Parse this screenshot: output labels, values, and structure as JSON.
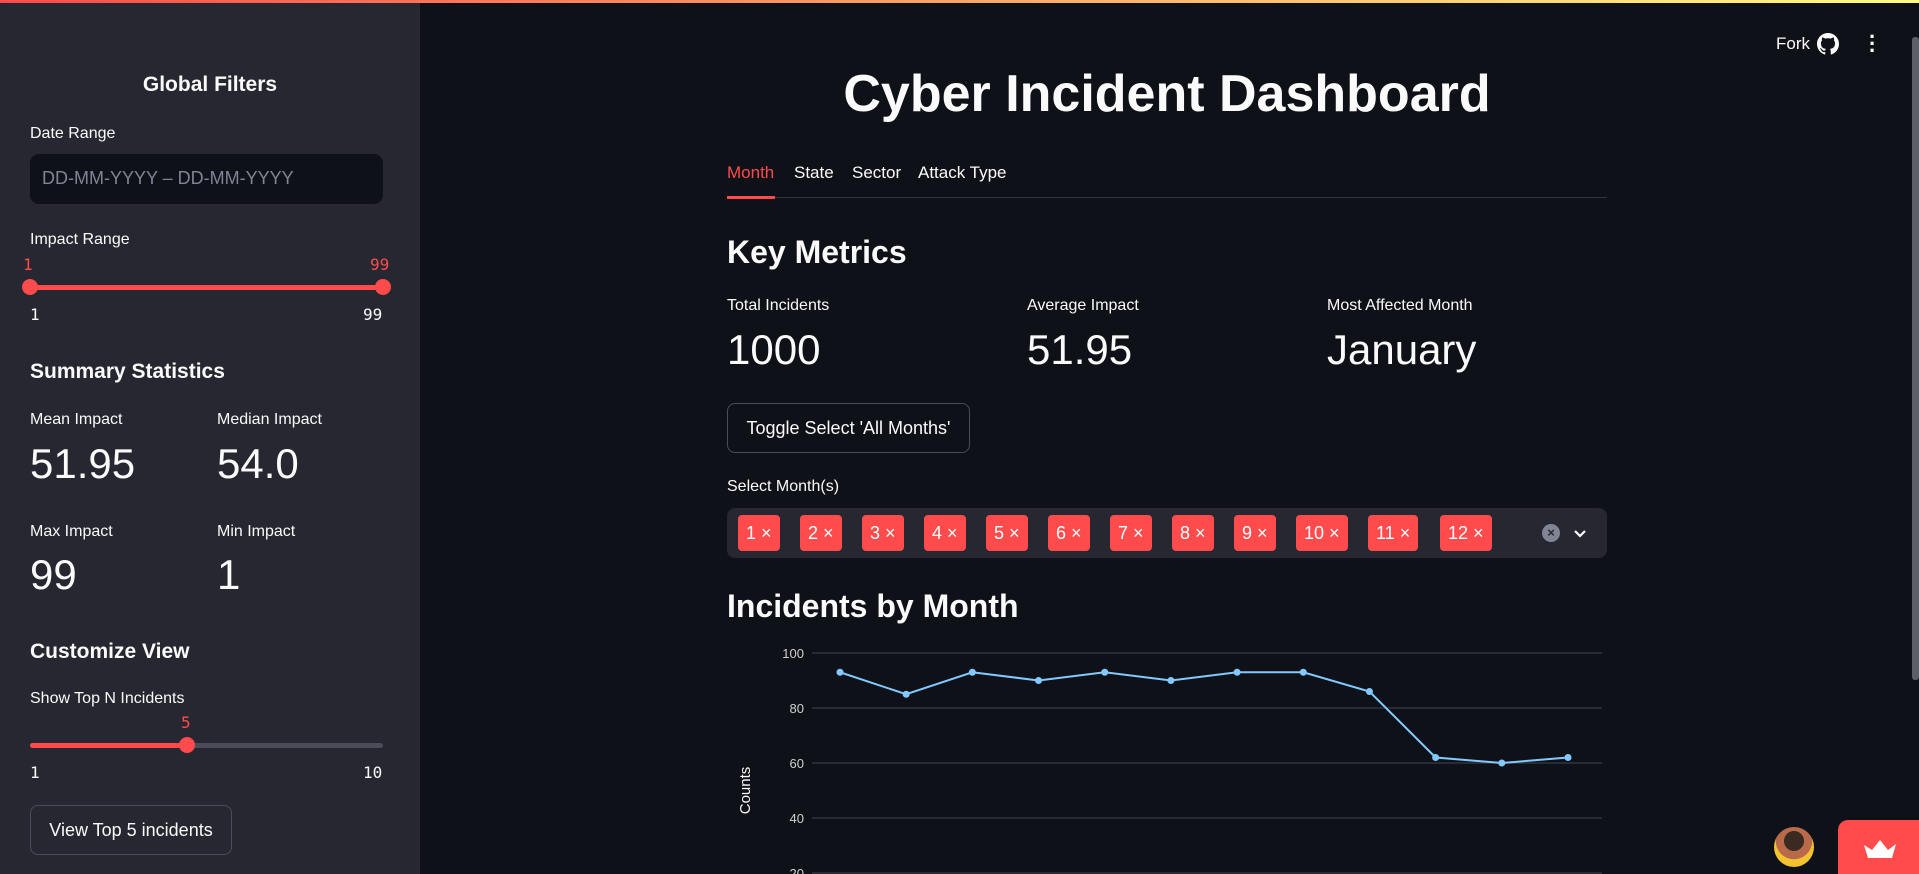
{
  "header": {
    "fork_label": "Fork",
    "icons": [
      "github-icon",
      "more-vertical-icon"
    ]
  },
  "sidebar": {
    "title": "Global Filters",
    "date_range": {
      "label": "Date Range",
      "placeholder": "DD-MM-YYYY – DD-MM-YYYY"
    },
    "impact_range": {
      "label": "Impact Range",
      "low": "1",
      "high": "99",
      "min": "1",
      "max": "99"
    },
    "summary": {
      "title": "Summary Statistics",
      "mean_label": "Mean Impact",
      "mean": "51.95",
      "median_label": "Median Impact",
      "median": "54.0",
      "max_label": "Max Impact",
      "max": "99",
      "min_label": "Min Impact",
      "min": "1"
    },
    "customize": {
      "title": "Customize View",
      "topn_label": "Show Top N Incidents",
      "topn_value": "5",
      "topn_min": "1",
      "topn_max": "10",
      "topn_fraction": 0.444,
      "view_button": "View Top 5 incidents"
    }
  },
  "main": {
    "title": "Cyber Incident Dashboard",
    "tabs": [
      {
        "label": "Month",
        "active": true
      },
      {
        "label": "State"
      },
      {
        "label": "Sector"
      },
      {
        "label": "Attack Type"
      }
    ],
    "key_metrics": {
      "title": "Key Metrics",
      "total_label": "Total Incidents",
      "total": "1000",
      "avg_label": "Average Impact",
      "avg": "51.95",
      "most_label": "Most Affected Month",
      "most": "January"
    },
    "toggle_button": "Toggle Select 'All Months'",
    "select_label": "Select Month(s)",
    "selected_months": [
      "1",
      "2",
      "3",
      "4",
      "5",
      "6",
      "7",
      "8",
      "9",
      "10",
      "11",
      "12"
    ],
    "chart_title": "Incidents by Month"
  },
  "colors": {
    "accent": "#ff4b4b",
    "line": "#83c9ff",
    "sidebar": "#262730",
    "background": "#0e1117"
  },
  "chart_data": {
    "type": "line",
    "x": [
      1,
      2,
      3,
      4,
      5,
      6,
      7,
      8,
      9,
      10,
      11,
      12
    ],
    "values": [
      93,
      85,
      93,
      90,
      93,
      90,
      93,
      93,
      86,
      62,
      60,
      62
    ],
    "ylabel": "Counts",
    "yticks": [
      "100",
      "80",
      "60",
      "40",
      "20"
    ],
    "grid": true
  }
}
